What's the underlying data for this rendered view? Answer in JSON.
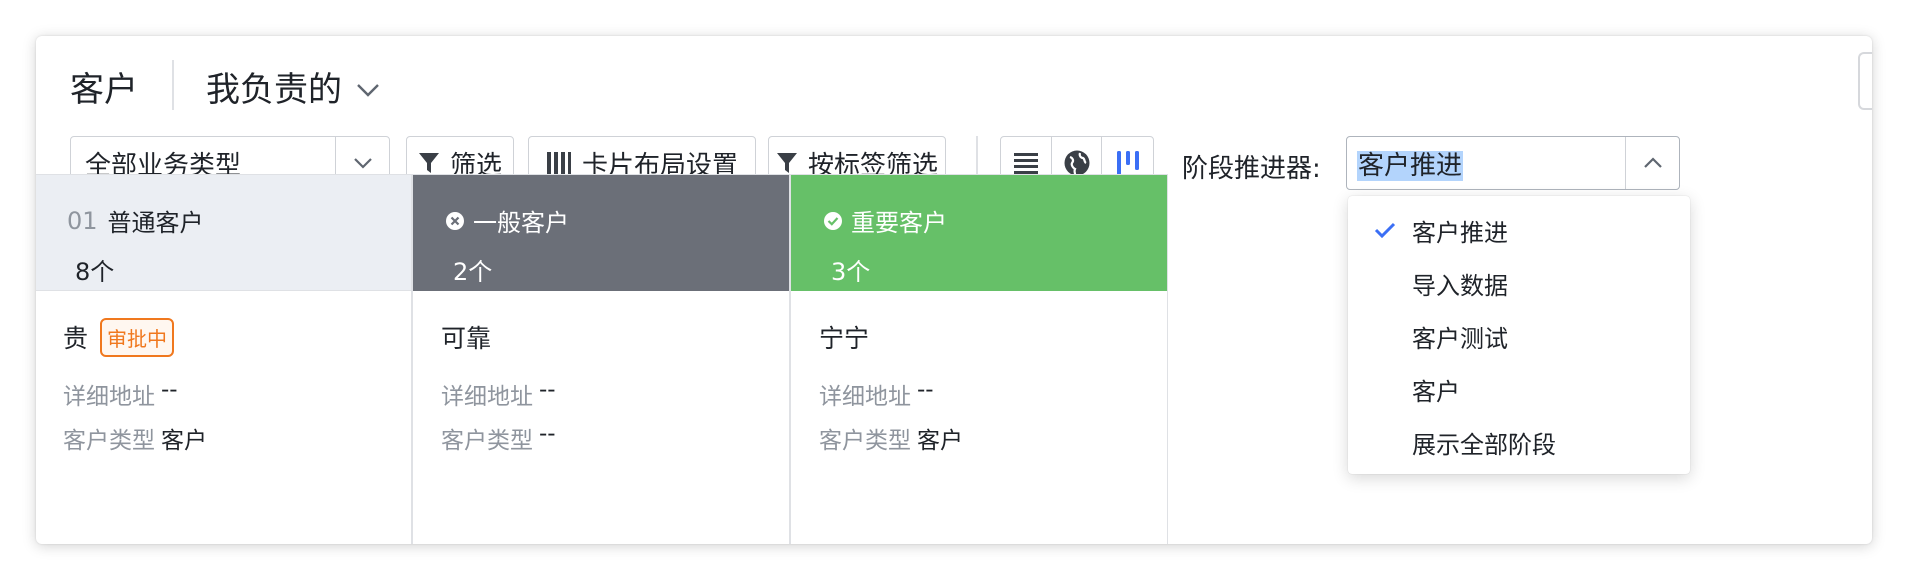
{
  "header": {
    "title": "客户",
    "view_label": "我负责的"
  },
  "toolbar": {
    "business_type": "全部业务类型",
    "filter_label": "筛选",
    "card_layout_label": "卡片布局设置",
    "tag_filter_label": "按标签筛选",
    "view_icons": [
      "list-view-icon",
      "globe-view-icon",
      "kanban-view-icon"
    ],
    "active_view": "kanban-view-icon",
    "stage_label": "阶段推进器:",
    "stage_value": "客户推进"
  },
  "stage_dropdown": {
    "items": [
      {
        "label": "客户推进",
        "selected": true
      },
      {
        "label": "导入数据",
        "selected": false
      },
      {
        "label": "客户测试",
        "selected": false
      },
      {
        "label": "客户",
        "selected": false
      },
      {
        "label": "展示全部阶段",
        "selected": false
      }
    ]
  },
  "columns": [
    {
      "index": "01",
      "name": "普通客户",
      "count": "8个",
      "color": "#ebeef3",
      "card": {
        "title": "贵",
        "badge": "审批中",
        "fields": [
          {
            "key": "详细地址",
            "value": "--"
          },
          {
            "key": "客户类型",
            "value": "客户"
          }
        ]
      }
    },
    {
      "name": "一般客户",
      "count": "2个",
      "icon": "x-circle-icon",
      "color": "#6b6f78",
      "card": {
        "title": "可靠",
        "fields": [
          {
            "key": "详细地址",
            "value": "--"
          },
          {
            "key": "客户类型",
            "value": "--"
          }
        ]
      }
    },
    {
      "name": "重要客户",
      "count": "3个",
      "icon": "check-circle-icon",
      "color": "#66c068",
      "card": {
        "title": "宁宁",
        "fields": [
          {
            "key": "详细地址",
            "value": "--"
          },
          {
            "key": "客户类型",
            "value": "客户"
          }
        ]
      }
    }
  ]
}
